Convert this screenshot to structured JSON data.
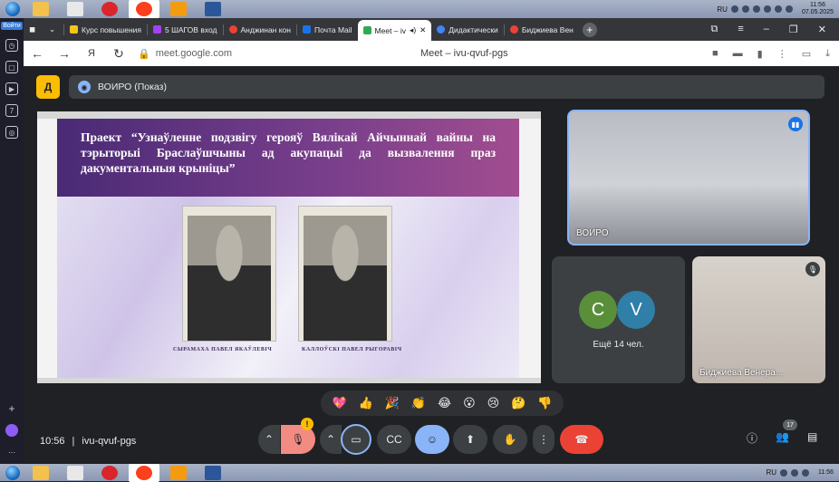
{
  "taskbar": {
    "clock_time": "11:56",
    "clock_date": "07.05.2025",
    "lang": "RU"
  },
  "sidebar": {
    "login_label": "Войти"
  },
  "tabs": [
    {
      "label": "Курс повышения",
      "color": "#f5c518"
    },
    {
      "label": "5 ШАГОВ вход",
      "color": "#a142f4"
    },
    {
      "label": "Анджинан кон",
      "color": "#ea4335"
    },
    {
      "label": "Почта Mail",
      "color": "#1a73e8"
    },
    {
      "label": "Meet – iv",
      "color": "#34a853",
      "active": true
    },
    {
      "label": "Дидактически",
      "color": "#4285f4"
    },
    {
      "label": "Биджиева Вен",
      "color": "#ea4335"
    }
  ],
  "address": {
    "url": "meet.google.com",
    "page_title": "Meet – ivu-qvuf-pgs"
  },
  "meet": {
    "presenter_label": "ВОИРО (Показ)",
    "logo_letter": "Д",
    "slide": {
      "heading": "Праект “Узнаўленне подзвігу герояў Вялікай Айчыннай вайны на тэрыторыі Браслаўшчыны ад акупацыі да вызвалення праз дакументальныя крыніцы”",
      "caption_left": "СЫРАМАХА ПАВЕЛ ЯКАЎЛЕВІЧ",
      "caption_right": "КАЛЛОЎСКІ ПАВЕЛ РЫГОРАВІЧ"
    },
    "camera_tile_name": "ВОИРО",
    "more_tile": {
      "bubble_1": "C",
      "bubble_2": "V",
      "text": "Ещё 14 чел."
    },
    "person_tile_name": "Биджиева Венера...",
    "reactions": [
      "💖",
      "👍",
      "🎉",
      "👏",
      "😂",
      "😮",
      "😢",
      "🤔",
      "👎"
    ],
    "meeting_time": "10:56",
    "meeting_code": "ivu-qvuf-pgs",
    "participant_count": "17",
    "colors": {
      "accent": "#8ab4f8",
      "end_call": "#ea4335",
      "warn": "#fbbc04"
    }
  }
}
